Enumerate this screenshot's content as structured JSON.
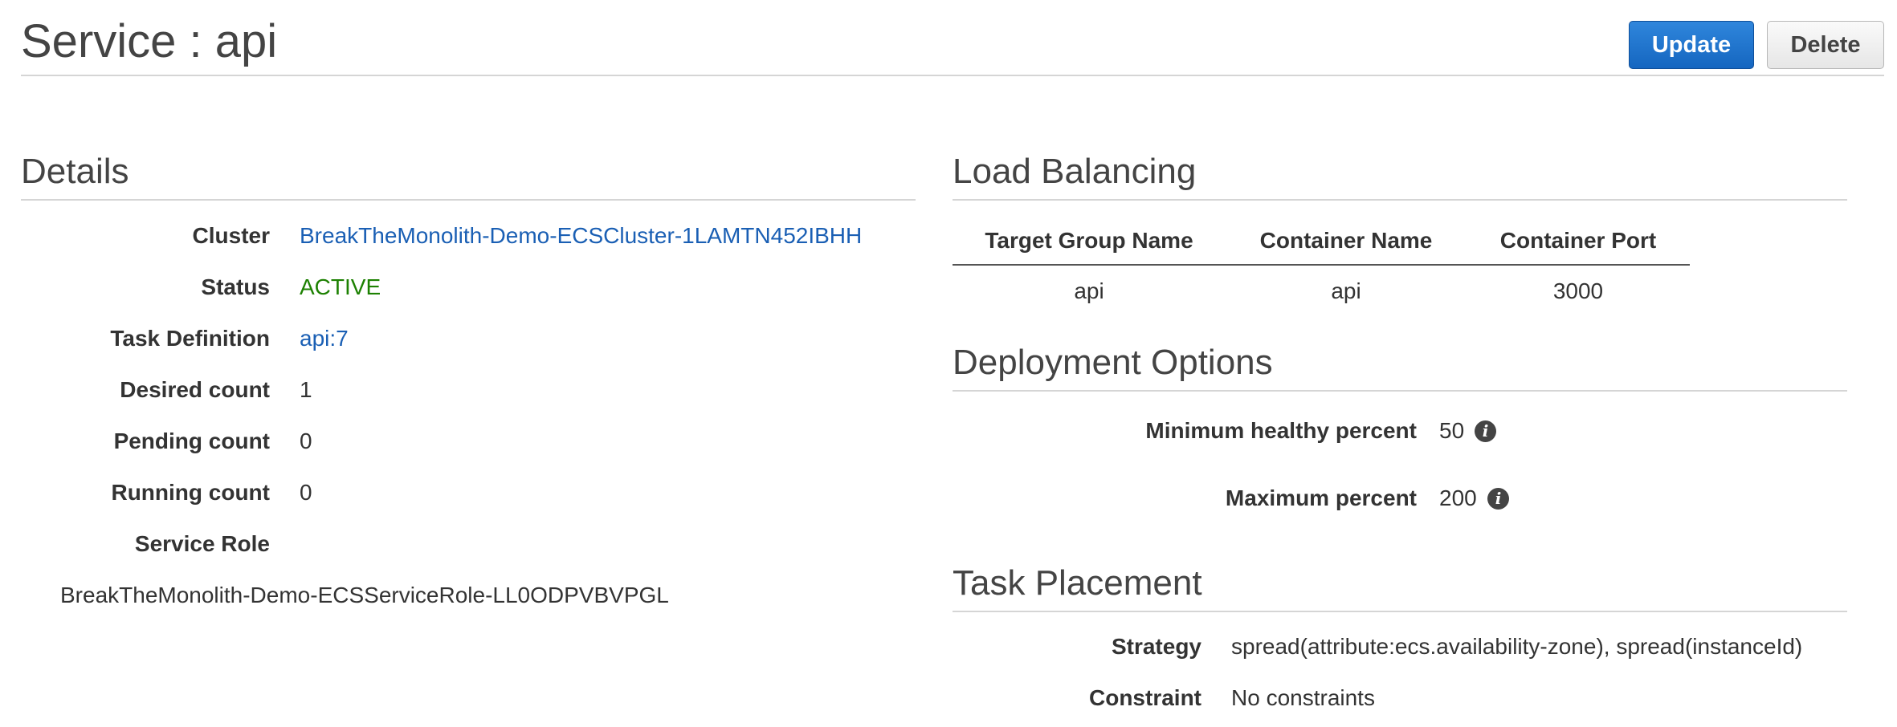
{
  "header": {
    "title": "Service : api",
    "update_label": "Update",
    "delete_label": "Delete"
  },
  "details": {
    "title": "Details",
    "cluster_label": "Cluster",
    "cluster_value": "BreakTheMonolith-Demo-ECSCluster-1LAMTN452IBHH",
    "status_label": "Status",
    "status_value": "ACTIVE",
    "task_definition_label": "Task Definition",
    "task_definition_value": "api:7",
    "desired_count_label": "Desired count",
    "desired_count_value": "1",
    "pending_count_label": "Pending count",
    "pending_count_value": "0",
    "running_count_label": "Running count",
    "running_count_value": "0",
    "service_role_label": "Service Role",
    "service_role_value": "BreakTheMonolith-Demo-ECSServiceRole-LL0ODPVBVPGL"
  },
  "load_balancing": {
    "title": "Load Balancing",
    "columns": [
      "Target Group Name",
      "Container Name",
      "Container Port"
    ],
    "rows": [
      [
        "api",
        "api",
        "3000"
      ]
    ]
  },
  "deployment_options": {
    "title": "Deployment Options",
    "min_healthy_label": "Minimum healthy percent",
    "min_healthy_value": "50",
    "max_percent_label": "Maximum percent",
    "max_percent_value": "200",
    "info_icon": "info-icon"
  },
  "task_placement": {
    "title": "Task Placement",
    "strategy_label": "Strategy",
    "strategy_value": "spread(attribute:ecs.availability-zone), spread(instanceId)",
    "constraint_label": "Constraint",
    "constraint_value": "No constraints"
  },
  "colors": {
    "primary_button": "#1a6ecb",
    "link": "#1a5fb4",
    "active_status": "#1d8102"
  }
}
